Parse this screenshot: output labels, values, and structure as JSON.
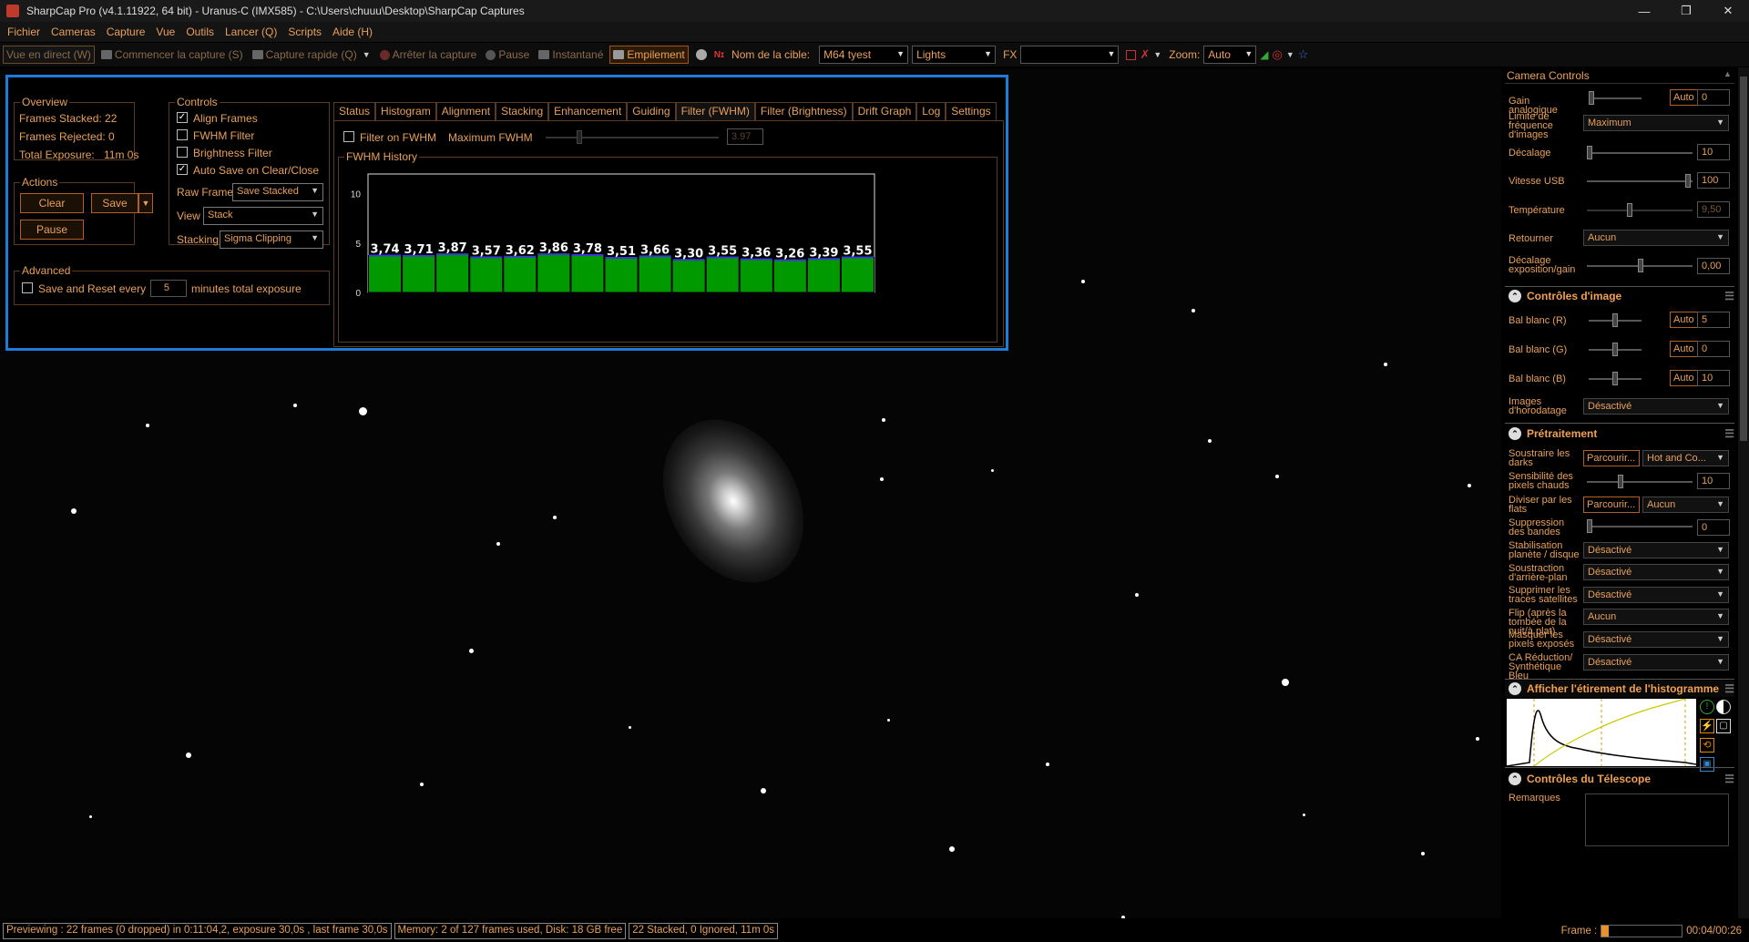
{
  "window": {
    "title": "SharpCap Pro (v4.1.11922, 64 bit) - Uranus-C (IMX585) - C:\\Users\\chuuu\\Desktop\\SharpCap Captures"
  },
  "menu": [
    "Fichier",
    "Cameras",
    "Capture",
    "Vue",
    "Outils",
    "Lancer (Q)",
    "Scripts",
    "Aide (H)"
  ],
  "toolbar": {
    "live": "Vue en direct (W)",
    "start": "Commencer la capture (S)",
    "quick": "Capture rapide (Q)",
    "stop": "Arrêter la capture",
    "pause": "Pause",
    "snapshot": "Instantané",
    "stack": "Empilement",
    "target_label": "Nom de la cible:",
    "target_value": "M64 tyest",
    "frame_type": "Lights",
    "fx_label": "FX",
    "zoom_label": "Zoom:",
    "zoom_value": "Auto"
  },
  "stack_panel": {
    "overview_title": "Overview",
    "frames_stacked": "Frames Stacked:  22",
    "frames_rejected": "Frames Rejected: 0",
    "total_exposure_label": "Total Exposure:",
    "total_exposure": "11m 0s",
    "actions_title": "Actions",
    "clear": "Clear",
    "save": "Save",
    "pause": "Pause",
    "controls_title": "Controls",
    "align_frames": "Align Frames",
    "fwhm_filter": "FWHM Filter",
    "brightness_filter": "Brightness Filter",
    "auto_save": "Auto Save on Clear/Close",
    "raw_frames_label": "Raw Frames",
    "raw_frames_value": "Save Stacked",
    "view_label": "View",
    "view_value": "Stack",
    "stacking_label": "Stacking",
    "stacking_value": "Sigma Clipping",
    "advanced_title": "Advanced",
    "save_reset": "Save and Reset every",
    "minutes_value": "5",
    "minutes_label": "minutes total exposure",
    "tabs": [
      "Status",
      "Histogram",
      "Alignment",
      "Stacking",
      "Enhancement",
      "Guiding",
      "Filter (FWHM)",
      "Filter (Brightness)",
      "Drift Graph",
      "Log",
      "Settings"
    ],
    "filter_on_fwhm": "Filter on FWHM",
    "max_fwhm_label": "Maximum FWHM",
    "max_fwhm_value": "3.97",
    "history_title": "FWHM History"
  },
  "chart_data": {
    "type": "bar",
    "title": "FWHM History",
    "categories": [
      "",
      "",
      "",
      "",
      "",
      "",
      "",
      "",
      "",
      "",
      "",
      "",
      "",
      "",
      ""
    ],
    "values": [
      3.74,
      3.71,
      3.87,
      3.57,
      3.62,
      3.86,
      3.78,
      3.51,
      3.66,
      3.3,
      3.55,
      3.36,
      3.26,
      3.39,
      3.55
    ],
    "labels": [
      "3,74",
      "3,71",
      "3,87",
      "3,57",
      "3,62",
      "3,86",
      "3,78",
      "3,51",
      "3,66",
      "3,30",
      "3,55",
      "3,36",
      "3,26",
      "3,39",
      "3,55"
    ],
    "yticks": [
      "0",
      "5",
      "10"
    ],
    "ylim": [
      0,
      12
    ],
    "bar_color": "#009900",
    "grid": false
  },
  "camera_controls": {
    "title": "Camera Controls",
    "gain_label": "Gain analogique",
    "gain_auto": "Auto",
    "gain_value": "0",
    "fps_label": "Limite de fréquence d'images",
    "fps_value": "Maximum",
    "offset_label": "Décalage",
    "offset_value": "10",
    "usb_label": "Vitesse USB",
    "usb_value": "100",
    "temp_label": "Température",
    "temp_value": "9,50",
    "flip_label": "Retourner",
    "flip_value": "Aucun",
    "expgain_label": "Décalage exposition/gain",
    "expgain_value": "0,00"
  },
  "image_controls": {
    "title": "Contrôles d'image",
    "wb_r_label": "Bal blanc (R)",
    "wb_r_auto": "Auto",
    "wb_r_value": "5",
    "wb_g_label": "Bal blanc (G)",
    "wb_g_auto": "Auto",
    "wb_g_value": "0",
    "wb_b_label": "Bal blanc (B)",
    "wb_b_auto": "Auto",
    "wb_b_value": "10",
    "timestamp_label": "Images d'horodatage",
    "timestamp_value": "Désactivé"
  },
  "preprocessing": {
    "title": "Prétraitement",
    "darks_label": "Soustraire les darks",
    "darks_browse": "Parcourir...",
    "darks_value": "Hot and Co...",
    "hotpix_label": "Sensibilité des pixels chauds",
    "hotpix_value": "10",
    "flats_label": "Diviser par les flats",
    "flats_browse": "Parcourir...",
    "flats_value": "Aucun",
    "banding_label": "Suppression des bandes",
    "banding_value": "0",
    "stab_label": "Stabilisation planète / disque",
    "stab_value": "Désactivé",
    "bg_label": "Soustraction d'arrière-plan",
    "bg_value": "Désactivé",
    "sat_label": "Supprimer les traces satellites",
    "sat_value": "Désactivé",
    "flip_label": "Flip (après la tombée de la nuit/à plat)",
    "flip_value": "Aucun",
    "mask_label": "Masquer les pixels exposés",
    "mask_value": "Désactivé",
    "blue_label": "CA Réduction/ Synthétique Bleu",
    "blue_value": "Désactivé"
  },
  "histogram": {
    "title": "Afficher l'étirement de l'histogramme"
  },
  "telescope": {
    "title": "Contrôles du Télescope",
    "notes_label": "Remarques"
  },
  "status": {
    "preview": "Previewing : 22 frames (0 dropped) in 0:11:04,2, exposure 30,0s , last frame 30,0s",
    "memory": "Memory: 2 of 127 frames used, Disk: 18 GB free",
    "stacked": "22 Stacked, 0 Ignored, 11m 0s",
    "frame_label": "Frame :",
    "time": "00:04/00:26"
  }
}
